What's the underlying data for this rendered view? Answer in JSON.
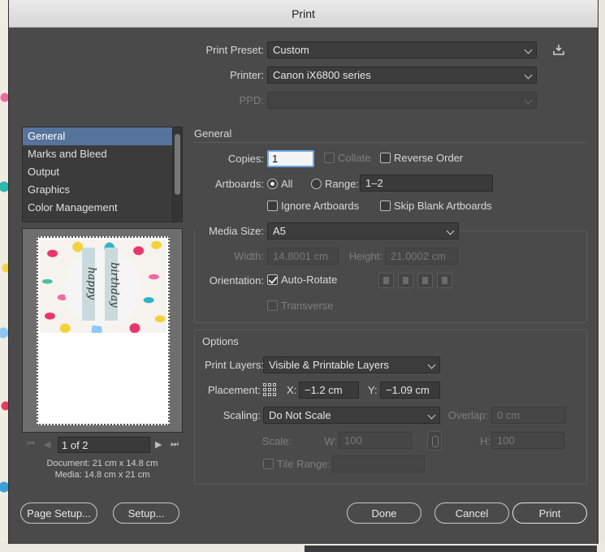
{
  "window": {
    "title": "Print"
  },
  "top": {
    "preset_label": "Print Preset:",
    "preset_value": "Custom",
    "printer_label": "Printer:",
    "printer_value": "Canon iX6800 series",
    "ppd_label": "PPD:",
    "ppd_value": ""
  },
  "sidebar": {
    "items": [
      {
        "label": "General"
      },
      {
        "label": "Marks and Bleed"
      },
      {
        "label": "Output"
      },
      {
        "label": "Graphics"
      },
      {
        "label": "Color Management"
      }
    ],
    "pager": {
      "value": "1 of 2"
    },
    "document_info": "Document: 21 cm x 14.8 cm",
    "media_info": "Media: 14.8 cm x 21 cm",
    "preview_text": [
      "happy",
      "birthday"
    ]
  },
  "general": {
    "title": "General",
    "copies_label": "Copies:",
    "copies_value": "1",
    "collate_label": "Collate",
    "collate_checked": false,
    "reverse_label": "Reverse Order",
    "reverse_checked": false,
    "artboards_label": "Artboards:",
    "all_label": "All",
    "all_selected": true,
    "range_label": "Range:",
    "range_value": "1–2",
    "ignore_label": "Ignore Artboards",
    "ignore_checked": false,
    "skip_label": "Skip Blank Artboards",
    "skip_checked": false
  },
  "media": {
    "size_label": "Media Size:",
    "size_value": "A5",
    "width_label": "Width:",
    "width_value": "14.8001 cm",
    "height_label": "Height:",
    "height_value": "21.0002 cm",
    "orientation_label": "Orientation:",
    "autorotate_label": "Auto-Rotate",
    "autorotate_checked": true,
    "transverse_label": "Transverse",
    "transverse_checked": false
  },
  "options": {
    "title": "Options",
    "layers_label": "Print Layers:",
    "layers_value": "Visible & Printable Layers",
    "placement_label": "Placement:",
    "x_label": "X:",
    "x_value": "−1.2 cm",
    "y_label": "Y:",
    "y_value": "−1.09 cm",
    "scaling_label": "Scaling:",
    "scaling_value": "Do Not Scale",
    "overlap_label": "Overlap:",
    "overlap_value": "0 cm",
    "scale_label": "Scale:",
    "w_label": "W:",
    "w_value": "100",
    "h_label": "H:",
    "h_value": "100",
    "tile_label": "Tile Range:",
    "tile_checked": false
  },
  "buttons": {
    "page_setup": "Page Setup...",
    "setup": "Setup...",
    "done": "Done",
    "cancel": "Cancel",
    "print": "Print"
  },
  "colors": {
    "selection": "#55739b",
    "dialog_bg": "#4a4a4a",
    "focus_ring": "#6ea8e8"
  }
}
